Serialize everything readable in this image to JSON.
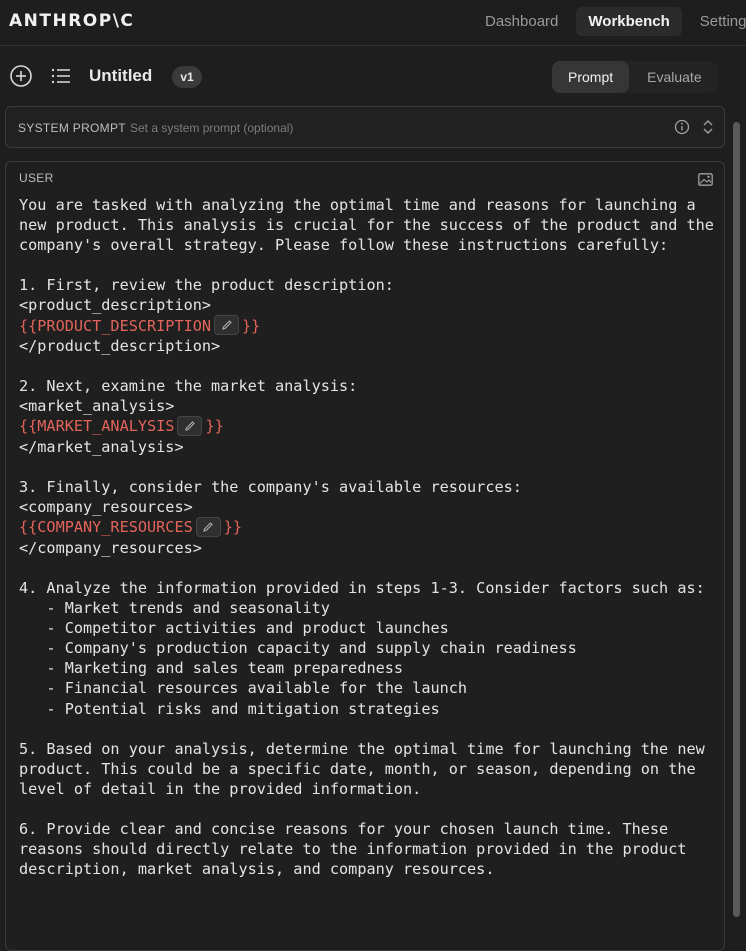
{
  "app": {
    "logo": "ANTHROP\\C"
  },
  "nav": {
    "items": [
      {
        "label": "Dashboard"
      },
      {
        "label": "Workbench"
      },
      {
        "label": "Settings"
      }
    ],
    "active": "Workbench"
  },
  "toolbar": {
    "title": "Untitled",
    "version": "v1",
    "modes": [
      {
        "label": "Prompt"
      },
      {
        "label": "Evaluate"
      }
    ],
    "active_mode": "Prompt"
  },
  "system_prompt": {
    "label": "SYSTEM PROMPT",
    "placeholder": "Set a system prompt (optional)"
  },
  "user_message": {
    "label": "USER",
    "intro": "You are tasked with analyzing the optimal time and reasons for launching a new product. This analysis is crucial for the success of the product and the company's overall strategy. Please follow these instructions carefully:",
    "step1": "1. First, review the product description:",
    "product_open": "<product_description>",
    "product_var": "{{PRODUCT_DESCRIPTION",
    "product_close": "</product_description>",
    "step2": "2. Next, examine the market analysis:",
    "market_open": "<market_analysis>",
    "market_var": "{{MARKET_ANALYSIS",
    "market_close": "</market_analysis>",
    "step3": "3. Finally, consider the company's available resources:",
    "resources_open": "<company_resources>",
    "resources_var": "{{COMPANY_RESOURCES",
    "resources_close": "</company_resources>",
    "var_suffix": "}}",
    "step4": "4. Analyze the information provided in steps 1-3. Consider factors such as:",
    "factors": [
      "   - Market trends and seasonality",
      "   - Competitor activities and product launches",
      "   - Company's production capacity and supply chain readiness",
      "   - Marketing and sales team preparedness",
      "   - Financial resources available for the launch",
      "   - Potential risks and mitigation strategies"
    ],
    "step5": "5. Based on your analysis, determine the optimal time for launching the new product. This could be a specific date, month, or season, depending on the level of detail in the provided information.",
    "step6": "6. Provide clear and concise reasons for your chosen launch time. These reasons should directly relate to the information provided in the product description, market analysis, and company resources."
  },
  "icons": {
    "new": "plus-circle-icon",
    "list": "list-icon",
    "info": "info-icon",
    "updown": "chevron-updown-icon",
    "image": "image-icon",
    "edit": "pencil-icon"
  },
  "colors": {
    "background": "#1e1e1e",
    "variable": "#e2645a"
  }
}
